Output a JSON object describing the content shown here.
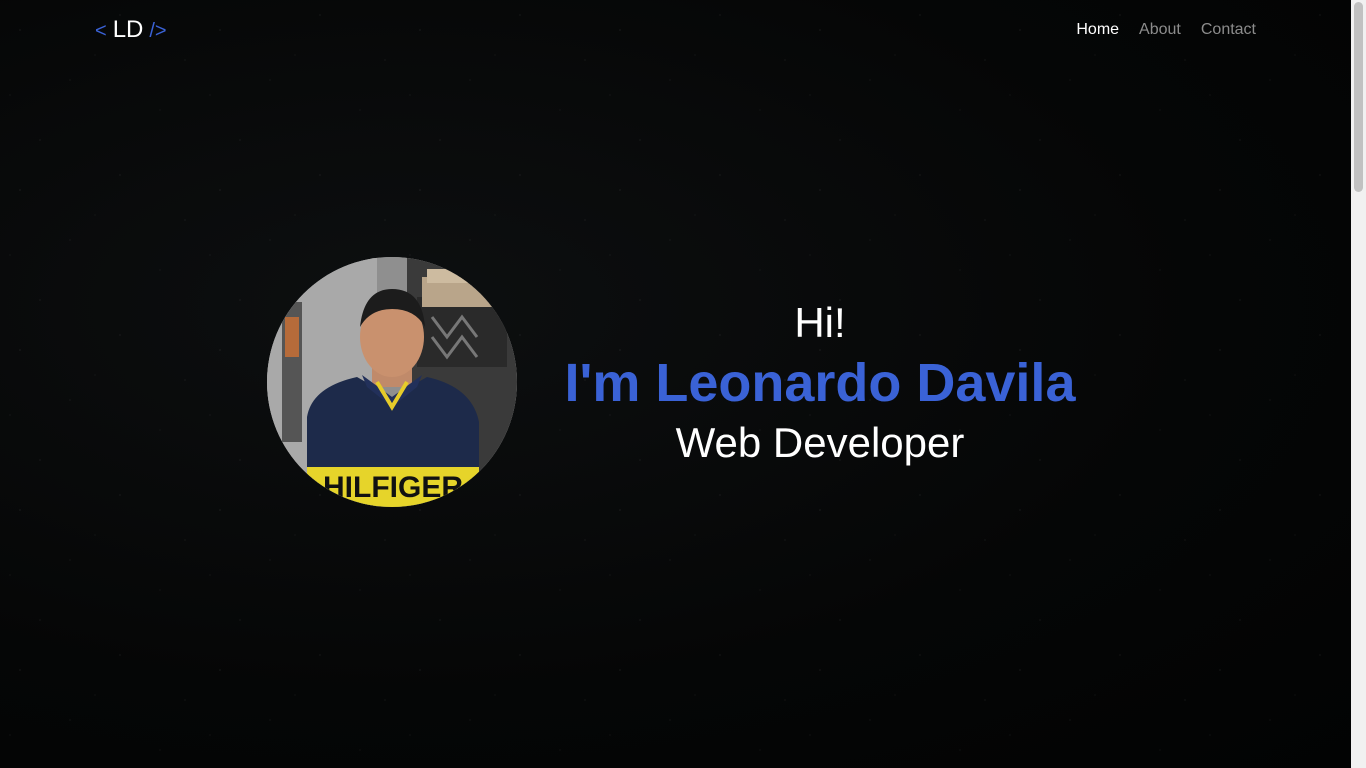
{
  "header": {
    "logo": {
      "left_bracket": "<",
      "initials": "LD",
      "right_bracket": "/>"
    },
    "nav": [
      {
        "label": "Home",
        "active": true
      },
      {
        "label": "About",
        "active": false
      },
      {
        "label": "Contact",
        "active": false
      }
    ]
  },
  "hero": {
    "greeting": "Hi!",
    "name": "I'm Leonardo Davila",
    "role": "Web Developer",
    "avatar_shirt_text": "HILFIGER"
  },
  "colors": {
    "accent": "#3a62d6",
    "text": "#ffffff",
    "nav_inactive": "#8c8c8c",
    "background": "#050606"
  }
}
